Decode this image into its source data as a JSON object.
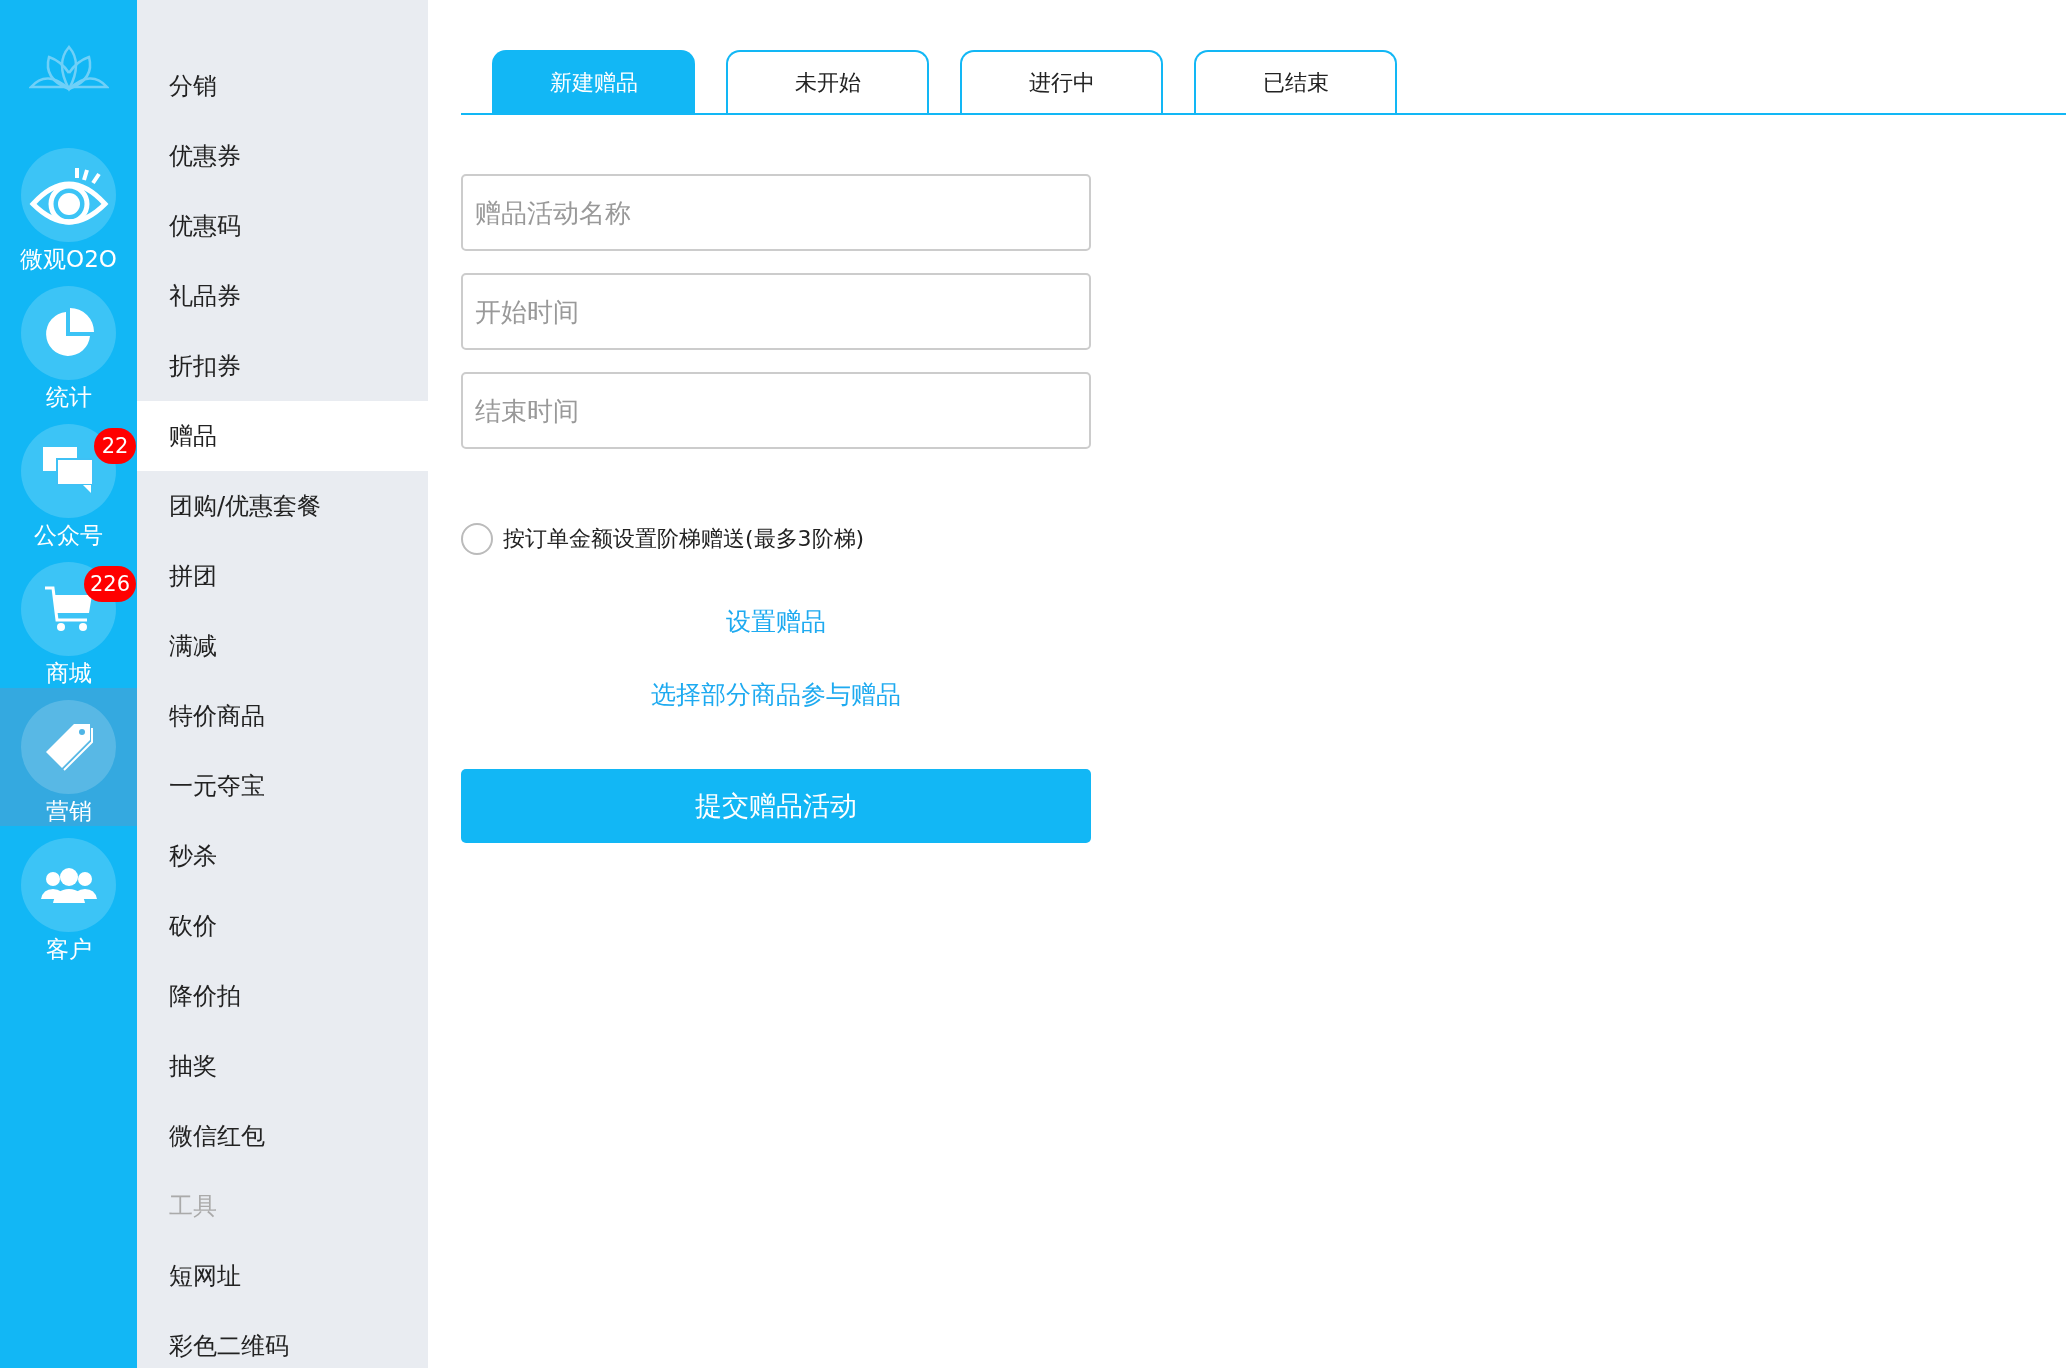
{
  "nav": [
    {
      "label": "微观O2O",
      "selected": false
    },
    {
      "label": "统计",
      "selected": false
    },
    {
      "label": "公众号",
      "selected": false,
      "badge": "22"
    },
    {
      "label": "商城",
      "selected": false,
      "badge": "226"
    },
    {
      "label": "营销",
      "selected": true
    },
    {
      "label": "客户",
      "selected": false
    }
  ],
  "menu": [
    {
      "kind": "item",
      "label": "分销",
      "selected": false
    },
    {
      "kind": "item",
      "label": "优惠券",
      "selected": false
    },
    {
      "kind": "item",
      "label": "优惠码",
      "selected": false
    },
    {
      "kind": "item",
      "label": "礼品券",
      "selected": false
    },
    {
      "kind": "item",
      "label": "折扣券",
      "selected": false
    },
    {
      "kind": "item",
      "label": "赠品",
      "selected": true
    },
    {
      "kind": "item",
      "label": "团购/优惠套餐",
      "selected": false
    },
    {
      "kind": "item",
      "label": "拼团",
      "selected": false
    },
    {
      "kind": "item",
      "label": "满减",
      "selected": false
    },
    {
      "kind": "item",
      "label": "特价商品",
      "selected": false
    },
    {
      "kind": "item",
      "label": "一元夺宝",
      "selected": false
    },
    {
      "kind": "item",
      "label": "秒杀",
      "selected": false
    },
    {
      "kind": "item",
      "label": "砍价",
      "selected": false
    },
    {
      "kind": "item",
      "label": "降价拍",
      "selected": false
    },
    {
      "kind": "item",
      "label": "抽奖",
      "selected": false
    },
    {
      "kind": "item",
      "label": "微信红包",
      "selected": false
    },
    {
      "kind": "heading",
      "label": "工具"
    },
    {
      "kind": "item",
      "label": "短网址",
      "selected": false
    },
    {
      "kind": "item",
      "label": "彩色二维码",
      "selected": false
    }
  ],
  "tabs": [
    {
      "label": "新建赠品",
      "selected": true
    },
    {
      "label": "未开始",
      "selected": false
    },
    {
      "label": "进行中",
      "selected": false
    },
    {
      "label": "已结束",
      "selected": false
    }
  ],
  "form": {
    "fields": [
      {
        "placeholder": "赠品活动名称"
      },
      {
        "placeholder": "开始时间"
      },
      {
        "placeholder": "结束时间"
      }
    ],
    "tiered_option": {
      "label": "按订单金额设置阶梯赠送(最多3阶梯)",
      "checked": false
    },
    "links": [
      "设置赠品",
      "选择部分商品参与赠品"
    ],
    "submit": "提交赠品活动"
  }
}
